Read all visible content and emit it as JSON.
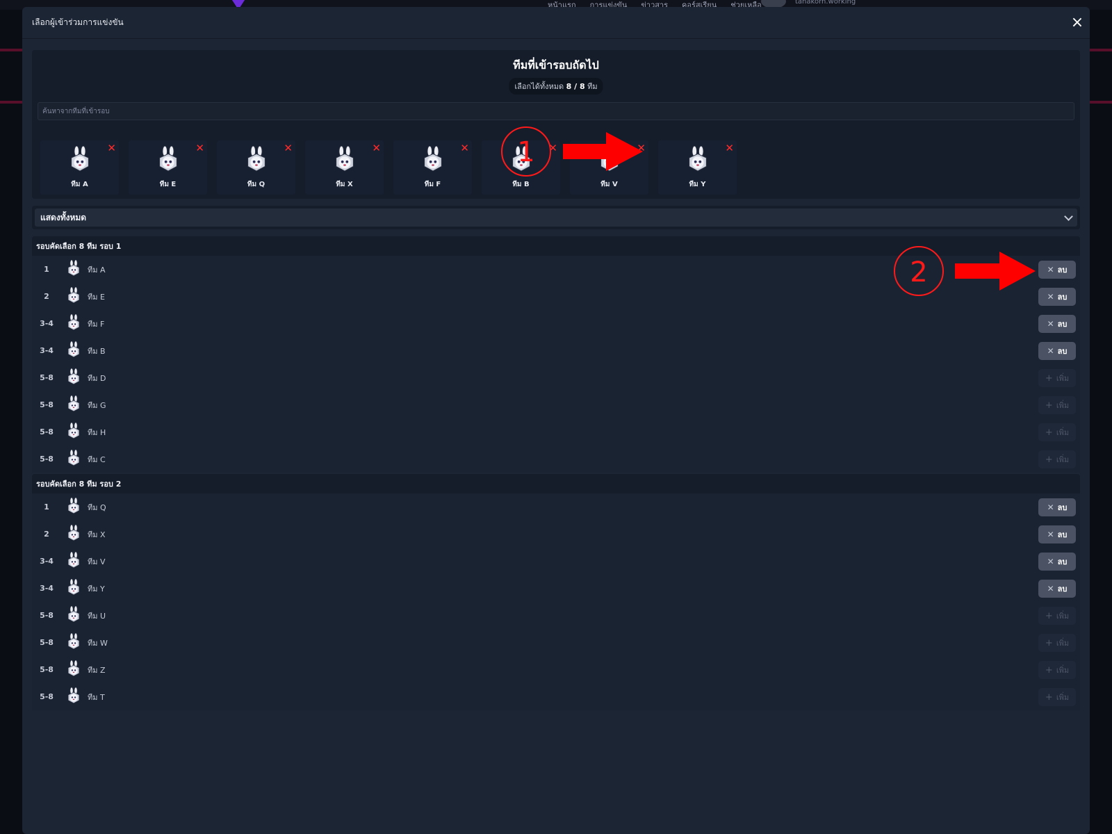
{
  "background": {
    "nav_links": [
      "หน้าแรก",
      "การแข่งขัน",
      "ข่าวสาร",
      "คอร์สเรียน",
      "ช่วยเหลือ"
    ],
    "username": "tanakorn.working"
  },
  "modal": {
    "title": "เลือกผู้เข้าร่วมการแข่งขัน",
    "close_icon": "×"
  },
  "next_round": {
    "title": "ทีมที่เข้ารอบถัดไป",
    "subtitle_prefix": "เลือกได้ทั้งหมด",
    "subtitle_count": "8 / 8",
    "subtitle_suffix": "ทีม",
    "search_placeholder": "ค้นหาจากทีมที่เข้ารอบ",
    "selected": [
      "ทีม A",
      "ทีม E",
      "ทีม Q",
      "ทีม X",
      "ทีม F",
      "ทีม B",
      "ทีม V",
      "ทีม Y"
    ],
    "remove_icon": "✕"
  },
  "filter": {
    "label": "แสดงทั้งหมด"
  },
  "groups": [
    {
      "title": "รอบคัดเลือก 8 ทีม รอบ 1",
      "rows": [
        {
          "rank": "1",
          "name": "ทีม A",
          "action": "ลบ",
          "selected": true
        },
        {
          "rank": "2",
          "name": "ทีม E",
          "action": "ลบ",
          "selected": true
        },
        {
          "rank": "3-4",
          "name": "ทีม F",
          "action": "ลบ",
          "selected": true
        },
        {
          "rank": "3-4",
          "name": "ทีม B",
          "action": "ลบ",
          "selected": true
        },
        {
          "rank": "5-8",
          "name": "ทีม D",
          "action": "เพิ่ม",
          "selected": false
        },
        {
          "rank": "5-8",
          "name": "ทีม G",
          "action": "เพิ่ม",
          "selected": false
        },
        {
          "rank": "5-8",
          "name": "ทีม H",
          "action": "เพิ่ม",
          "selected": false
        },
        {
          "rank": "5-8",
          "name": "ทีม C",
          "action": "เพิ่ม",
          "selected": false
        }
      ]
    },
    {
      "title": "รอบคัดเลือก 8 ทีม รอบ 2",
      "rows": [
        {
          "rank": "1",
          "name": "ทีม Q",
          "action": "ลบ",
          "selected": true
        },
        {
          "rank": "2",
          "name": "ทีม X",
          "action": "ลบ",
          "selected": true
        },
        {
          "rank": "3-4",
          "name": "ทีม V",
          "action": "ลบ",
          "selected": true
        },
        {
          "rank": "3-4",
          "name": "ทีม Y",
          "action": "ลบ",
          "selected": true
        },
        {
          "rank": "5-8",
          "name": "ทีม U",
          "action": "เพิ่ม",
          "selected": false
        },
        {
          "rank": "5-8",
          "name": "ทีม W",
          "action": "เพิ่ม",
          "selected": false
        },
        {
          "rank": "5-8",
          "name": "ทีม Z",
          "action": "เพิ่ม",
          "selected": false
        },
        {
          "rank": "5-8",
          "name": "ทีม T",
          "action": "เพิ่ม",
          "selected": false
        }
      ]
    }
  ],
  "annotations": [
    "1",
    "2"
  ],
  "colors": {
    "accent_red": "#ff1a1a",
    "modal_bg": "#1c2533",
    "delete_btn": "#4a5263"
  }
}
